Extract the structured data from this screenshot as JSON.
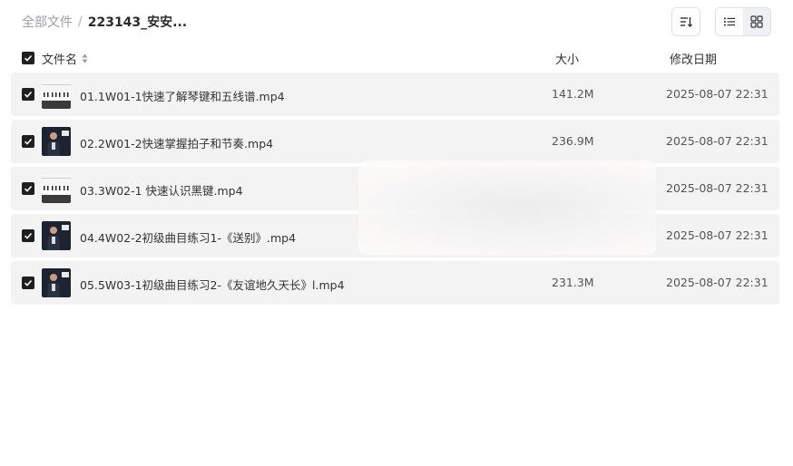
{
  "breadcrumb": {
    "root": "全部文件",
    "separator": "/",
    "current": "223143_安安..."
  },
  "toolbar": {
    "sort_icon": "sort-lines-icon",
    "list_icon": "list-view-icon",
    "grid_icon": "grid-view-icon",
    "active_view": "list"
  },
  "table": {
    "headers": {
      "name": "文件名",
      "size": "大小",
      "date": "修改日期"
    },
    "select_all_checked": true,
    "rows": [
      {
        "name": "01.1W01-1快速了解琴键和五线谱.mp4",
        "size": "141.2M",
        "date": "2025-08-07 22:31",
        "checked": true,
        "thumb": "piano-keys"
      },
      {
        "name": "02.2W01-2快速掌握拍子和节奏.mp4",
        "size": "236.9M",
        "date": "2025-08-07 22:31",
        "checked": true,
        "thumb": "presenter"
      },
      {
        "name": "03.3W02-1 快速认识黑键.mp4",
        "size": "",
        "date": "2025-08-07 22:31",
        "checked": true,
        "thumb": "piano-keys"
      },
      {
        "name": "04.4W02-2初级曲目练习1-《送别》.mp4",
        "size": "",
        "date": "2025-08-07 22:31",
        "checked": true,
        "thumb": "presenter"
      },
      {
        "name": "05.5W03-1初级曲目练习2-《友谊地久天长》l.mp4",
        "size": "231.3M",
        "date": "2025-08-07 22:31",
        "checked": true,
        "thumb": "presenter"
      }
    ]
  },
  "colors": {
    "row_bg": "#f3f3f4",
    "checkbox": "#1f1f1f",
    "text": "#333333",
    "muted": "#9aa0a6"
  }
}
